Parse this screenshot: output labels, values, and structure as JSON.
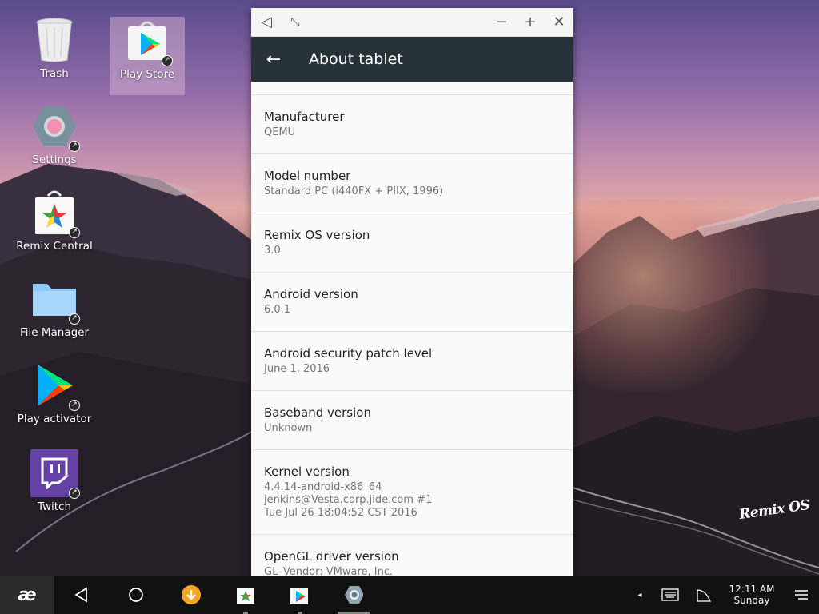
{
  "desktop": {
    "icons": [
      {
        "label": "Trash",
        "icon": "trash-icon"
      },
      {
        "label": "Play Store",
        "icon": "play-store-icon"
      },
      {
        "label": "Settings",
        "icon": "settings-icon"
      },
      {
        "label": "Remix Central",
        "icon": "remix-central-icon"
      },
      {
        "label": "File Manager",
        "icon": "folder-icon"
      },
      {
        "label": "Play activator",
        "icon": "play-activator-icon"
      },
      {
        "label": "Twitch",
        "icon": "twitch-icon"
      }
    ],
    "watermark": "Remix OS"
  },
  "window": {
    "title": "About tablet",
    "rows": [
      {
        "label": "Manufacturer",
        "value": "QEMU"
      },
      {
        "label": "Model number",
        "value": "Standard PC (i440FX + PIIX, 1996)"
      },
      {
        "label": "Remix OS version",
        "value": "3.0"
      },
      {
        "label": "Android version",
        "value": "6.0.1"
      },
      {
        "label": "Android security patch level",
        "value": "June 1, 2016"
      },
      {
        "label": "Baseband version",
        "value": "Unknown"
      },
      {
        "label": "Kernel version",
        "value": "4.4.14-android-x86_64\njenkins@Vesta.corp.jide.com #1\nTue Jul 26 18:04:52 CST 2016"
      },
      {
        "label": "OpenGL driver version",
        "value": "GL_Vendor: VMware, Inc."
      }
    ]
  },
  "taskbar": {
    "start_label": "æ",
    "time": "12:11 AM",
    "day": "Sunday"
  },
  "colors": {
    "appbar": "#263238",
    "taskbar": "#111111",
    "download_badge": "#f5a623",
    "twitch": "#6441a4"
  }
}
